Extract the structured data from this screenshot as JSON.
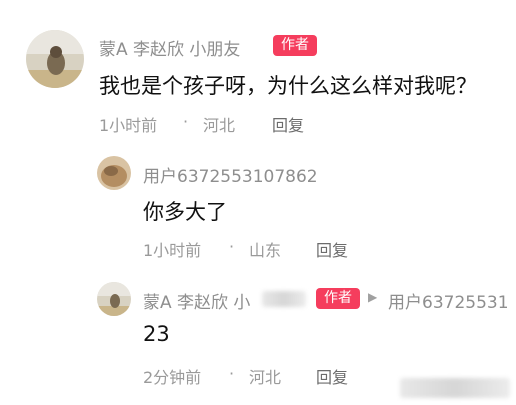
{
  "comment1": {
    "username": "蒙A 李赵欣 小朋友",
    "badge": "作者",
    "text": "我也是个孩子呀，为什么这么样对我呢？",
    "time": "1小时前",
    "dot": "·",
    "location": "河北",
    "reply_label": "回复"
  },
  "comment2": {
    "username": "用户6372553107862",
    "text": "你多大了",
    "time": "1小时前",
    "dot": "·",
    "location": "山东",
    "reply_label": "回复"
  },
  "comment3": {
    "username": "蒙A 李赵欣 小",
    "badge": "作者",
    "arrow": "▶",
    "reply_to": "用户63725531",
    "text": "23",
    "time": "2分钟前",
    "dot": "·",
    "location": "河北",
    "reply_label": "回复"
  },
  "colors": {
    "badge": "#f53d5d",
    "name": "#8e8e8e",
    "meta": "#9a9a9a",
    "text": "#111111"
  }
}
